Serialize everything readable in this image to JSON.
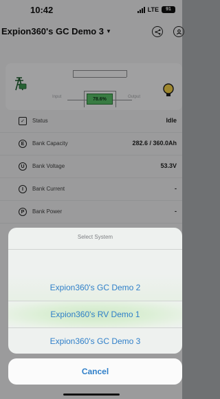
{
  "status_bar": {
    "time": "10:42",
    "network": "LTE",
    "battery": "91"
  },
  "header": {
    "system_title": "Expion360's GC Demo 3",
    "icons": [
      "share-icon",
      "profile-icon"
    ]
  },
  "flow": {
    "input_label": "Input",
    "output_label": "Output",
    "soc": "78.6%",
    "icons": [
      "grid-tower-icon",
      "bulb-icon"
    ]
  },
  "details": [
    {
      "icon": "checkbox-icon",
      "letter": "✓",
      "label": "Status",
      "value": "Idle"
    },
    {
      "icon": "e-circle-icon",
      "letter": "E",
      "label": "Bank Capacity",
      "value": "282.6 / 360.0Ah"
    },
    {
      "icon": "u-circle-icon",
      "letter": "U",
      "label": "Bank Voltage",
      "value": "53.3V"
    },
    {
      "icon": "i-circle-icon",
      "letter": "I",
      "label": "Bank Current",
      "value": "-"
    },
    {
      "icon": "p-circle-icon",
      "letter": "P",
      "label": "Bank Power",
      "value": "-"
    }
  ],
  "sheet": {
    "title": "Select System",
    "options": [
      "Expion360's GC Demo 2",
      "Expion360's RV Demo 1",
      "Expion360's GC Demo 3"
    ],
    "cancel": "Cancel"
  },
  "colors": {
    "accent": "#2f7fc9",
    "soc_fill": "#59c36a"
  }
}
